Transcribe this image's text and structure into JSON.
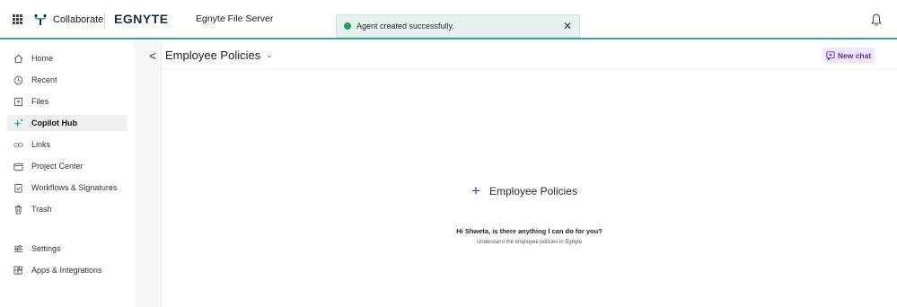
{
  "topbar": {
    "collaborate_label": "Collaborate",
    "brand": "EGNYTE",
    "brand_sub": "Egnyte File Server",
    "accent_color": "#3aa69a"
  },
  "toast": {
    "message": "Agent created successfully.",
    "close_symbol": "✕",
    "status_color": "#2f9a5e"
  },
  "sidebar": {
    "items": [
      {
        "label": "Home",
        "icon": "home-icon",
        "active": false
      },
      {
        "label": "Recent",
        "icon": "clock-icon",
        "active": false
      },
      {
        "label": "Files",
        "icon": "files-icon",
        "active": false
      },
      {
        "label": "Copilot Hub",
        "icon": "sparkle-icon",
        "active": true
      },
      {
        "label": "Links",
        "icon": "link-icon",
        "active": false
      },
      {
        "label": "Project Center",
        "icon": "folder-icon",
        "active": false
      },
      {
        "label": "Workflows & Signatures",
        "icon": "clipboard-check-icon",
        "active": false
      },
      {
        "label": "Trash",
        "icon": "trash-icon",
        "active": false
      },
      {
        "label": "Settings",
        "icon": "sliders-icon",
        "active": false
      },
      {
        "label": "Apps & Integrations",
        "icon": "apps-icon",
        "active": false
      }
    ]
  },
  "main": {
    "back_symbol": "<",
    "title": "Employee Policies",
    "title_chevron": "⌄",
    "new_chat_label": "New chat",
    "agent_plus": "+",
    "agent_name": "Employee Policies",
    "greeting": "Hi Shweta, is there anything I can do for you?",
    "subtext": "Understand the employee policies in Egnyte",
    "brand_purple": "#5b2fb0"
  }
}
